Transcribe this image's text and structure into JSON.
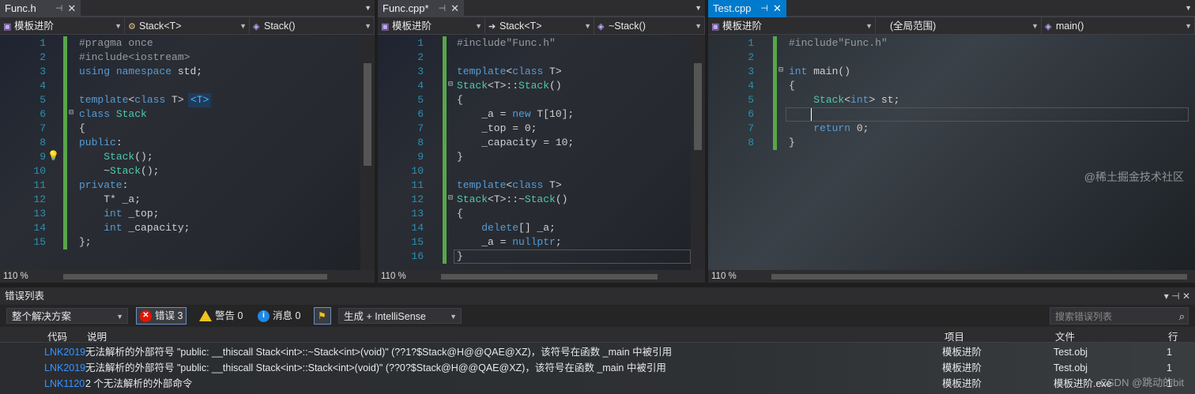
{
  "pane1": {
    "tab": "Func.h",
    "nav": [
      "模板进阶",
      "Stack<T>",
      "Stack()"
    ],
    "zoom": "110 %",
    "lines": [
      {
        "n": "1",
        "t": "#pragma once"
      },
      {
        "n": "2",
        "t": "#include<iostream>"
      },
      {
        "n": "3",
        "t": "using namespace std;"
      },
      {
        "n": "4",
        "t": ""
      },
      {
        "n": "5",
        "t": "template<class T>"
      },
      {
        "n": "6",
        "t": "class Stack"
      },
      {
        "n": "7",
        "t": "{"
      },
      {
        "n": "8",
        "t": "public:"
      },
      {
        "n": "9",
        "t": "    Stack();"
      },
      {
        "n": "10",
        "t": "    ~Stack();"
      },
      {
        "n": "11",
        "t": "private:"
      },
      {
        "n": "12",
        "t": "    T* _a;"
      },
      {
        "n": "13",
        "t": "    int _top;"
      },
      {
        "n": "14",
        "t": "    int _capacity;"
      },
      {
        "n": "15",
        "t": "};"
      }
    ],
    "template_hint": "<T>"
  },
  "pane2": {
    "tab": "Func.cpp*",
    "nav": [
      "模板进阶",
      "Stack<T>",
      "~Stack()"
    ],
    "zoom": "110 %",
    "lines": [
      {
        "n": "1",
        "t": "#include\"Func.h\""
      },
      {
        "n": "2",
        "t": ""
      },
      {
        "n": "3",
        "t": "template<class T>"
      },
      {
        "n": "4",
        "t": "Stack<T>::Stack()"
      },
      {
        "n": "5",
        "t": "{"
      },
      {
        "n": "6",
        "t": "    _a = new T[10];"
      },
      {
        "n": "7",
        "t": "    _top = 0;"
      },
      {
        "n": "8",
        "t": "    _capacity = 10;"
      },
      {
        "n": "9",
        "t": "}"
      },
      {
        "n": "10",
        "t": ""
      },
      {
        "n": "11",
        "t": "template<class T>"
      },
      {
        "n": "12",
        "t": "Stack<T>::~Stack()"
      },
      {
        "n": "13",
        "t": "{"
      },
      {
        "n": "14",
        "t": "    delete[] _a;"
      },
      {
        "n": "15",
        "t": "    _a = nullptr;"
      },
      {
        "n": "16",
        "t": "}"
      }
    ]
  },
  "pane3": {
    "tab": "Test.cpp",
    "nav": [
      "模板进阶",
      "(全局范围)",
      "main()"
    ],
    "zoom": "110 %",
    "lines": [
      {
        "n": "1",
        "t": "#include\"Func.h\""
      },
      {
        "n": "2",
        "t": ""
      },
      {
        "n": "3",
        "t": "int main()"
      },
      {
        "n": "4",
        "t": "{"
      },
      {
        "n": "5",
        "t": "    Stack<int> st;"
      },
      {
        "n": "6",
        "t": ""
      },
      {
        "n": "7",
        "t": "    return 0;"
      },
      {
        "n": "8",
        "t": "}"
      }
    ]
  },
  "errors": {
    "title": "错误列表",
    "scope": "整个解决方案",
    "errors_label": "错误 3",
    "warnings_label": "警告 0",
    "messages_label": "消息 0",
    "build_filter": "生成 + IntelliSense",
    "search_placeholder": "搜索错误列表",
    "columns": {
      "code": "代码",
      "desc": "说明",
      "project": "项目",
      "file": "文件",
      "line": "行"
    },
    "rows": [
      {
        "code": "LNK2019",
        "desc": "无法解析的外部符号 \"public: __thiscall Stack<int>::~Stack<int>(void)\" (??1?$Stack@H@@QAE@XZ)，该符号在函数 _main 中被引用",
        "project": "模板进阶",
        "file": "Test.obj",
        "line": "1"
      },
      {
        "code": "LNK2019",
        "desc": "无法解析的外部符号 \"public: __thiscall Stack<int>::Stack<int>(void)\" (??0?$Stack@H@@QAE@XZ)，该符号在函数 _main 中被引用",
        "project": "模板进阶",
        "file": "Test.obj",
        "line": "1"
      },
      {
        "code": "LNK1120",
        "desc": "2 个无法解析的外部命令",
        "project": "模板进阶",
        "file": "模板进阶.exe",
        "line": "1"
      }
    ]
  },
  "watermark": "CSDN @跳动的bit",
  "watermark2": "@稀土掘金技术社区"
}
